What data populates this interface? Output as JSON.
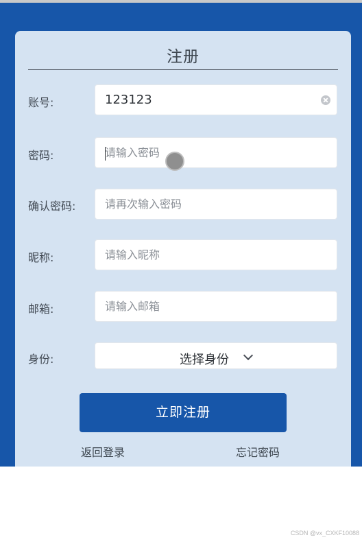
{
  "form": {
    "title": "注册",
    "account": {
      "label": "账号:",
      "value": "123123"
    },
    "password": {
      "label": "密码:",
      "placeholder": "请输入密码"
    },
    "confirm_password": {
      "label": "确认密码:",
      "placeholder": "请再次输入密码"
    },
    "nickname": {
      "label": "昵称:",
      "placeholder": "请输入昵称"
    },
    "email": {
      "label": "邮箱:",
      "placeholder": "请输入邮箱"
    },
    "identity": {
      "label": "身份:",
      "selected": "选择身份"
    },
    "submit_label": "立即注册",
    "back_to_login": "返回登录",
    "forgot_password": "忘记密码"
  },
  "watermark": "CSDN @vx_CXKF10088",
  "colors": {
    "primary": "#1756a9",
    "card": "#d5e3f2"
  }
}
